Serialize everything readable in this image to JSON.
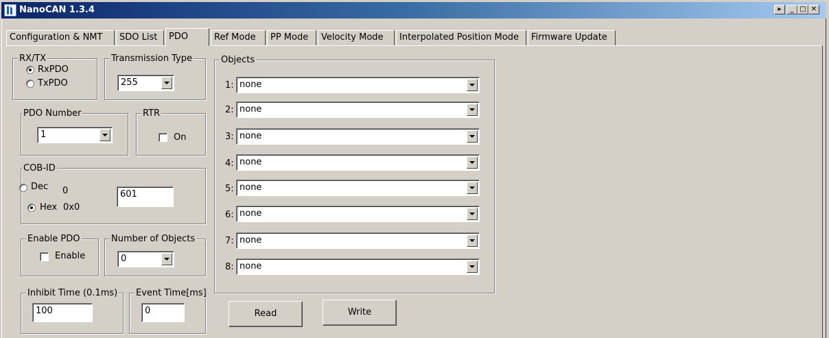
{
  "window": {
    "title": "NanoCAN 1.3.4",
    "caption_buttons": [
      "▸",
      "_",
      "□",
      "✕"
    ]
  },
  "tabs": [
    {
      "label": "Configuration & NMT"
    },
    {
      "label": "SDO List"
    },
    {
      "label": "PDO",
      "active": true
    },
    {
      "label": "Ref Mode"
    },
    {
      "label": "PP Mode"
    },
    {
      "label": "Velocity Mode"
    },
    {
      "label": "Interpolated Position Mode"
    },
    {
      "label": "Firmware Update"
    }
  ],
  "rxtx": {
    "label": "RX/TX",
    "options": [
      {
        "label": "RxPDO",
        "selected": true
      },
      {
        "label": "TxPDO",
        "selected": false
      }
    ]
  },
  "transmission_type": {
    "label": "Transmission Type",
    "value": "255"
  },
  "pdo_number": {
    "label": "PDO Number",
    "value": "1"
  },
  "rtr": {
    "label": "RTR",
    "checkbox_label": "On",
    "checked": false
  },
  "cob_id": {
    "label": "COB-ID",
    "dec_label": "Dec",
    "dec_value": "0",
    "hex_label": "Hex",
    "hex_value": "0x0",
    "selected": "Hex",
    "input_value": "601"
  },
  "enable_pdo": {
    "label": "Enable PDO",
    "checkbox_label": "Enable",
    "checked": false
  },
  "number_of_objects": {
    "label": "Number of Objects",
    "value": "0"
  },
  "inhibit_time": {
    "label": "Inhibit Time (0.1ms)",
    "value": "100"
  },
  "event_time": {
    "label": "Event Time[ms]",
    "value": "0"
  },
  "objects": {
    "label": "Objects",
    "rows": [
      {
        "index": "1:",
        "value": "none"
      },
      {
        "index": "2:",
        "value": "none"
      },
      {
        "index": "3:",
        "value": "none"
      },
      {
        "index": "4:",
        "value": "none"
      },
      {
        "index": "5:",
        "value": "none"
      },
      {
        "index": "6:",
        "value": "none"
      },
      {
        "index": "7:",
        "value": "none"
      },
      {
        "index": "8:",
        "value": "none"
      }
    ]
  },
  "actions": {
    "read_label": "Read",
    "write_label": "Write"
  },
  "colors": {
    "titlebar_start": "#0a246a",
    "titlebar_end": "#a6caf0",
    "face": "#d4d0c8"
  }
}
